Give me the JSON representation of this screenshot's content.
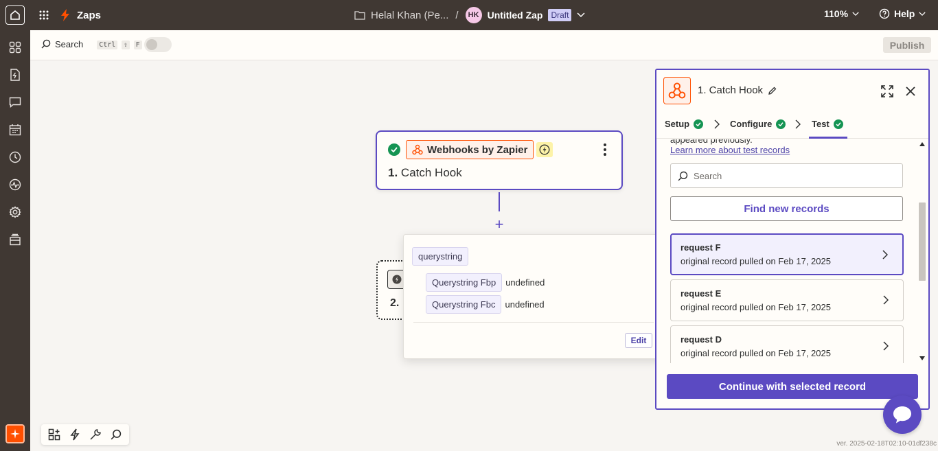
{
  "topbar": {
    "app_name": "Zaps",
    "folder": "Helal Khan (Pe...",
    "separator": "/",
    "avatar_initials": "HK",
    "zap_title": "Untitled Zap",
    "status_badge": "Draft",
    "zoom": "110%",
    "help": "Help"
  },
  "rail": {
    "icons": [
      "apps-icon",
      "zap-file-icon",
      "chat-icon",
      "calendar-icon",
      "history-icon",
      "activity-icon",
      "settings-icon",
      "stack-icon"
    ]
  },
  "toolbar": {
    "search_label": "Search",
    "shortcut_keys": [
      "Ctrl",
      "⇧",
      "F"
    ],
    "publish_label": "Publish"
  },
  "step1": {
    "app_name": "Webhooks by Zapier",
    "number": "1.",
    "title": "Catch Hook"
  },
  "step2": {
    "number": "2."
  },
  "popover": {
    "tag": "querystring",
    "rows": [
      {
        "key": "Querystring Fbp",
        "value": "undefined"
      },
      {
        "key": "Querystring Fbc",
        "value": "undefined"
      }
    ],
    "edit_label": "Edit"
  },
  "panel": {
    "title": "1. Catch Hook",
    "tabs": [
      {
        "label": "Setup",
        "complete": true
      },
      {
        "label": "Configure",
        "complete": true
      },
      {
        "label": "Test",
        "complete": true,
        "active": true
      }
    ],
    "intro_tail": "appeared previously.",
    "learn_link": "Learn more about test records",
    "search_placeholder": "Search",
    "find_button": "Find new records",
    "records": [
      {
        "title": "request F",
        "subtitle": "original record pulled on Feb 17, 2025",
        "selected": true
      },
      {
        "title": "request E",
        "subtitle": "original record pulled on Feb 17, 2025",
        "selected": false
      },
      {
        "title": "request D",
        "subtitle": "original record pulled on Feb 17, 2025",
        "selected": false
      }
    ],
    "continue_button": "Continue with selected record"
  },
  "version": "ver. 2025-02-18T02:10-01df238c",
  "colors": {
    "accent": "#5b4ac2",
    "brand": "#ff4f00",
    "success": "#159453",
    "topbar": "#403833"
  }
}
